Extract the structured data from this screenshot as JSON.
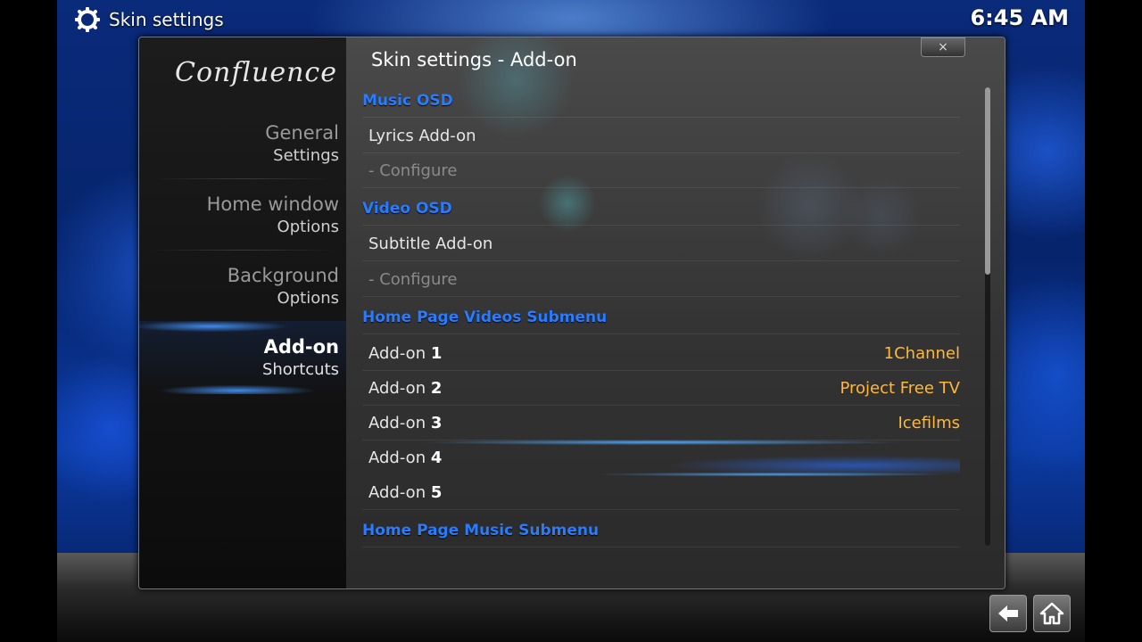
{
  "header": {
    "window_title": "Skin settings",
    "clock": "6:45 AM"
  },
  "dialog": {
    "logo": "Confluence",
    "title": "Skin settings - Add-on",
    "close_label": "×"
  },
  "categories": [
    {
      "line1": "General",
      "line2": "Settings",
      "active": false
    },
    {
      "line1": "Home window",
      "line2": "Options",
      "active": false
    },
    {
      "line1": "Background",
      "line2": "Options",
      "active": false
    },
    {
      "line1": "Add-on",
      "line2": "Shortcuts",
      "active": true
    }
  ],
  "settings": {
    "music_osd": {
      "header": "Music OSD",
      "lyrics": "Lyrics Add-on",
      "configure": "- Configure"
    },
    "video_osd": {
      "header": "Video OSD",
      "subtitle": "Subtitle Add-on",
      "configure": "- Configure"
    },
    "videos_submenu": {
      "header": "Home Page Videos Submenu",
      "items": [
        {
          "label": "Add-on",
          "num": "1",
          "value": "1Channel"
        },
        {
          "label": "Add-on",
          "num": "2",
          "value": "Project Free TV"
        },
        {
          "label": "Add-on",
          "num": "3",
          "value": "Icefilms"
        },
        {
          "label": "Add-on",
          "num": "4",
          "value": ""
        },
        {
          "label": "Add-on",
          "num": "5",
          "value": ""
        }
      ]
    },
    "music_submenu": {
      "header": "Home Page Music Submenu"
    }
  },
  "colors": {
    "section_header": "#2a7cff",
    "value": "#ffb83a",
    "focus_glow": "#50aaff"
  },
  "icons": {
    "window": "gear-icon",
    "back": "back-arrow-icon",
    "home": "home-icon"
  }
}
